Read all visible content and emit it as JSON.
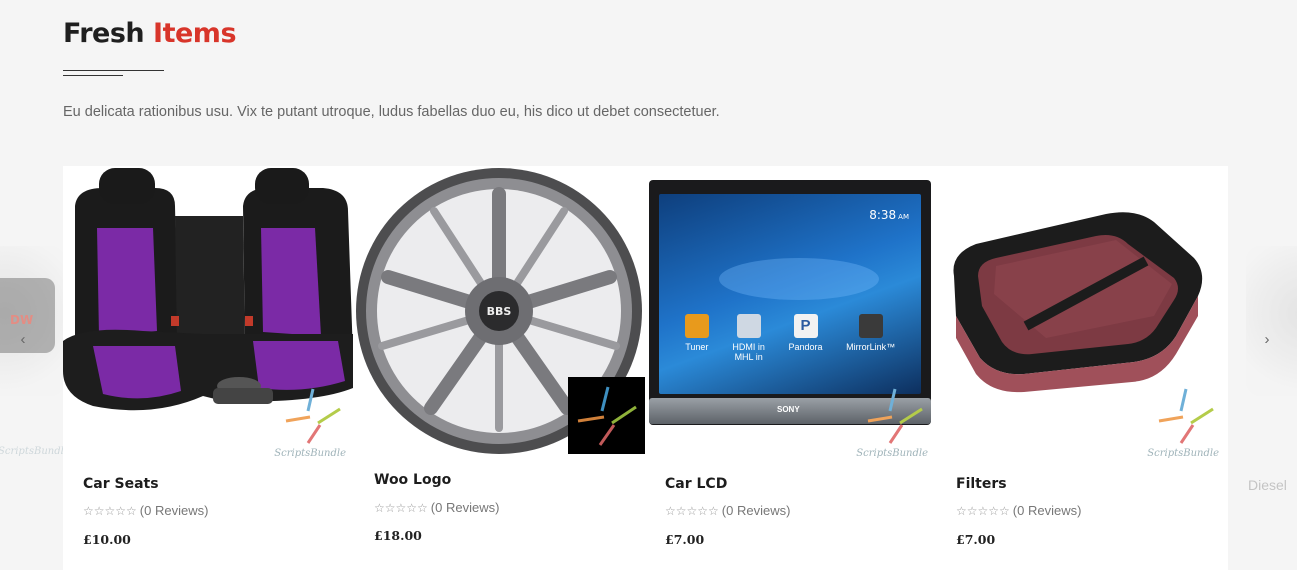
{
  "section": {
    "title_main": "Fresh",
    "title_accent": "Items",
    "intro": "Eu delicata rationibus usu. Vix te putant utroque, ludus fabellas duo eu, his dico ut debet consectetuer."
  },
  "colors": {
    "accent": "#d8352a",
    "title": "#1f1f1f",
    "background": "#f5f5f5"
  },
  "carousel": {
    "prev_icon": "chevron-left-icon",
    "next_icon": "chevron-right-icon",
    "prev_glyph": "‹",
    "next_glyph": "›",
    "next_peek_name": "Diesel",
    "prev_peek_watermark": "ScriptsBundle"
  },
  "products": [
    {
      "name": "Car Seats",
      "reviews": "(0 Reviews)",
      "price": "£10.00",
      "stars": "☆☆☆☆☆",
      "watermark": "ScriptsBundle"
    },
    {
      "name": "Woo Logo",
      "reviews": "(0 Reviews)",
      "price": "£18.00",
      "stars": "☆☆☆☆☆",
      "watermark": ""
    },
    {
      "name": "Car LCD",
      "reviews": "(0 Reviews)",
      "price": "£7.00",
      "stars": "☆☆☆☆☆",
      "watermark": "ScriptsBundle",
      "screen": {
        "time": "8:38",
        "ampm": "AM",
        "apps": [
          "Tuner",
          "HDMI in\nMHL in",
          "Pandora",
          "MirrorLink™"
        ],
        "brand": "SONY"
      }
    },
    {
      "name": "Filters",
      "reviews": "(0 Reviews)",
      "price": "£7.00",
      "stars": "☆☆☆☆☆",
      "watermark": "ScriptsBundle"
    }
  ]
}
